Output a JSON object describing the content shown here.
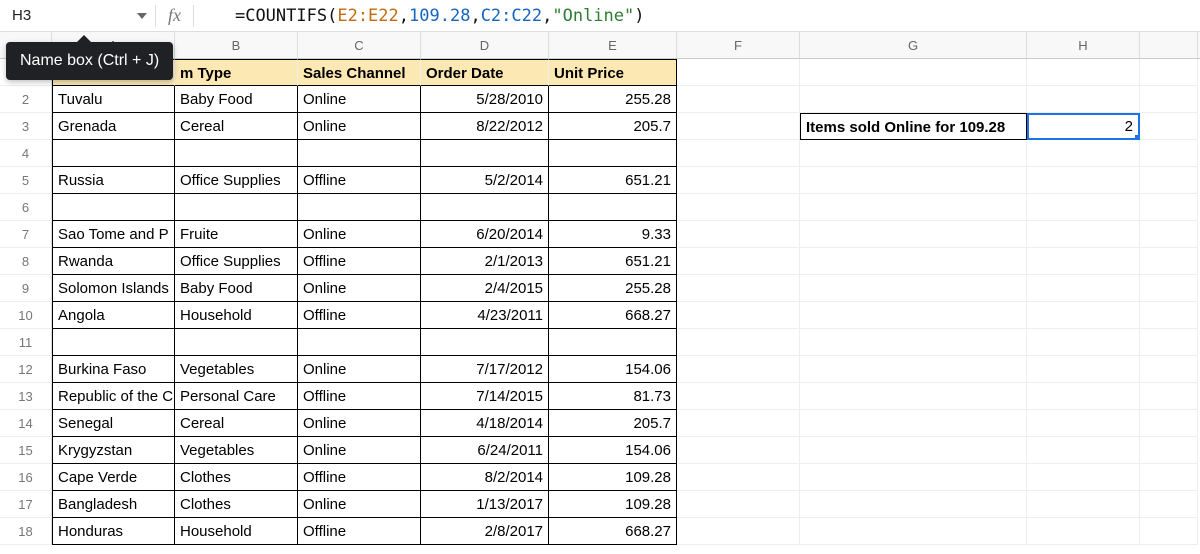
{
  "nameBox": {
    "value": "H3",
    "tooltip": "Name box (Ctrl + J)"
  },
  "fxLabel": "fx",
  "formula": {
    "raw": "=COUNTIFS(E2:E22,109.28,C2:C22,\"Online\")",
    "parts": {
      "eq": "=",
      "fn": "COUNTIFS",
      "lp": "(",
      "r1": "E2:E22",
      "c1": ",",
      "n1": "109.28",
      "c2": ",",
      "r2": "C2:C22",
      "c3": ",",
      "s1": "\"Online\"",
      "rp": ")"
    }
  },
  "columns": [
    "A",
    "B",
    "C",
    "D",
    "E",
    "F",
    "G",
    "H",
    ""
  ],
  "headerRow": {
    "A": "",
    "B": "m Type",
    "C": "Sales Channel",
    "D": "Order Date",
    "E": "Unit Price"
  },
  "summary": {
    "label": "Items sold Online for 109.28",
    "value": "2"
  },
  "rows": [
    {
      "n": "2",
      "A": "Tuvalu",
      "B": "Baby Food",
      "C": "Online",
      "D": "5/28/2010",
      "E": "255.28"
    },
    {
      "n": "3",
      "A": "Grenada",
      "B": "Cereal",
      "C": "Online",
      "D": "8/22/2012",
      "E": "205.7"
    },
    {
      "n": "4",
      "A": "",
      "B": "",
      "C": "",
      "D": "",
      "E": ""
    },
    {
      "n": "5",
      "A": "Russia",
      "B": "Office Supplies",
      "C": "Offline",
      "D": "5/2/2014",
      "E": "651.21"
    },
    {
      "n": "6",
      "A": "",
      "B": "",
      "C": "",
      "D": "",
      "E": ""
    },
    {
      "n": "7",
      "A": "Sao Tome and P",
      "B": "Fruite",
      "C": "Online",
      "D": "6/20/2014",
      "E": "9.33"
    },
    {
      "n": "8",
      "A": "Rwanda",
      "B": "Office Supplies",
      "C": "Offline",
      "D": "2/1/2013",
      "E": "651.21"
    },
    {
      "n": "9",
      "A": "Solomon Islands",
      "B": "Baby Food",
      "C": "Online",
      "D": "2/4/2015",
      "E": "255.28"
    },
    {
      "n": "10",
      "A": "Angola",
      "B": "Household",
      "C": "Offline",
      "D": "4/23/2011",
      "E": "668.27"
    },
    {
      "n": "11",
      "A": "",
      "B": "",
      "C": "",
      "D": "",
      "E": ""
    },
    {
      "n": "12",
      "A": "Burkina Faso",
      "B": "Vegetables",
      "C": "Online",
      "D": "7/17/2012",
      "E": "154.06"
    },
    {
      "n": "13",
      "A": "Republic of the C",
      "B": "Personal Care",
      "C": "Offline",
      "D": "7/14/2015",
      "E": "81.73"
    },
    {
      "n": "14",
      "A": "Senegal",
      "B": "Cereal",
      "C": "Online",
      "D": "4/18/2014",
      "E": "205.7"
    },
    {
      "n": "15",
      "A": "Krygyzstan",
      "B": "Vegetables",
      "C": "Online",
      "D": "6/24/2011",
      "E": "154.06"
    },
    {
      "n": "16",
      "A": "Cape Verde",
      "B": "Clothes",
      "C": "Offline",
      "D": "8/2/2014",
      "E": "109.28"
    },
    {
      "n": "17",
      "A": "Bangladesh",
      "B": "Clothes",
      "C": "Online",
      "D": "1/13/2017",
      "E": "109.28"
    },
    {
      "n": "18",
      "A": "Honduras",
      "B": "Household",
      "C": "Offline",
      "D": "2/8/2017",
      "E": "668.27"
    }
  ]
}
